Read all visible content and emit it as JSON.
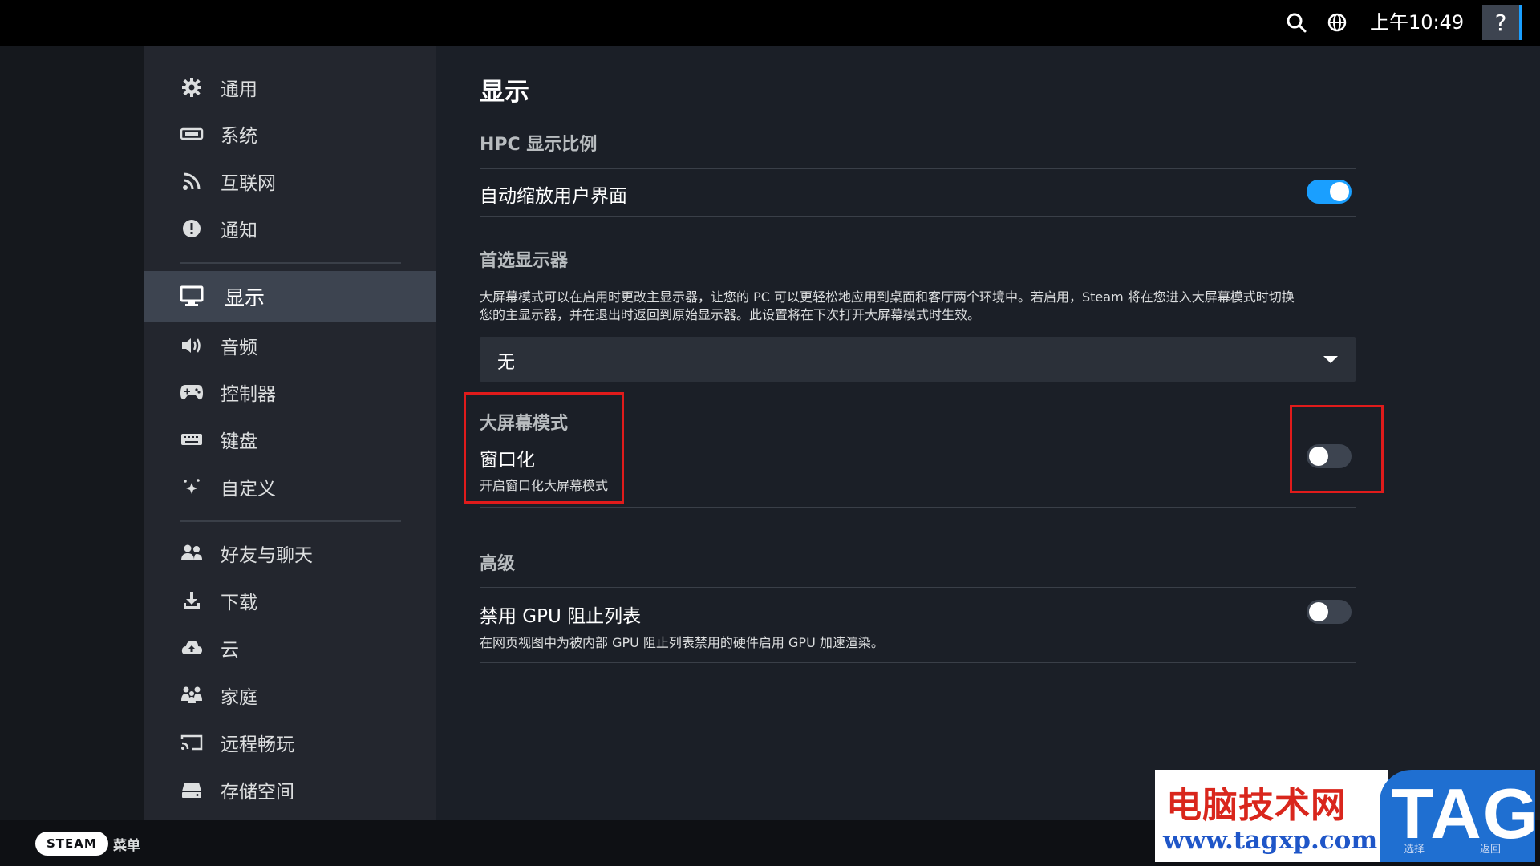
{
  "topbar": {
    "clock": "上午10:49",
    "help": "?"
  },
  "sidebar": {
    "items": [
      {
        "label": "通用",
        "icon": "gear-icon"
      },
      {
        "label": "系统",
        "icon": "system-icon"
      },
      {
        "label": "互联网",
        "icon": "wifi-icon"
      },
      {
        "label": "通知",
        "icon": "notification-icon"
      },
      {
        "label": "显示",
        "icon": "monitor-icon",
        "active": true
      },
      {
        "label": "音频",
        "icon": "speaker-icon"
      },
      {
        "label": "控制器",
        "icon": "gamepad-icon"
      },
      {
        "label": "键盘",
        "icon": "keyboard-icon"
      },
      {
        "label": "自定义",
        "icon": "sparkle-icon"
      },
      {
        "label": "好友与聊天",
        "icon": "friends-icon"
      },
      {
        "label": "下载",
        "icon": "download-icon"
      },
      {
        "label": "云",
        "icon": "cloud-icon"
      },
      {
        "label": "家庭",
        "icon": "family-icon"
      },
      {
        "label": "远程畅玩",
        "icon": "cast-icon"
      },
      {
        "label": "存储空间",
        "icon": "storage-icon"
      }
    ]
  },
  "main": {
    "title": "显示",
    "hpc": {
      "heading": "HPC 显示比例",
      "auto_scale_label": "自动缩放用户界面",
      "auto_scale_on": true
    },
    "preferred": {
      "heading": "首选显示器",
      "desc_line1": "大屏幕模式可以在启用时更改主显示器，让您的 PC 可以更轻松地应用到桌面和客厅两个环境中。若启用，Steam 将在您进入大屏幕模式时切换",
      "desc_line2": "您的主显示器，并在退出时返回到原始显示器。此设置将在下次打开大屏幕模式时生效。",
      "dropdown_value": "无"
    },
    "bigpicture": {
      "heading": "大屏幕模式",
      "windowed_label": "窗口化",
      "windowed_desc": "开启窗口化大屏幕模式",
      "windowed_on": false
    },
    "advanced": {
      "heading": "高级",
      "gpu_label": "禁用 GPU 阻止列表",
      "gpu_desc": "在网页视图中为被内部 GPU 阻止列表禁用的硬件启用 GPU 加速渲染。",
      "gpu_on": false
    }
  },
  "bottombar": {
    "steam": "STEAM",
    "menu": "菜单"
  },
  "watermark": {
    "title": "电脑技术网",
    "url": "www.tagxp.com",
    "tag": "TAG",
    "btn_a": "选择",
    "btn_b": "返回"
  },
  "colors": {
    "accent": "#1a9fff",
    "highlight": "#e01b1b"
  }
}
